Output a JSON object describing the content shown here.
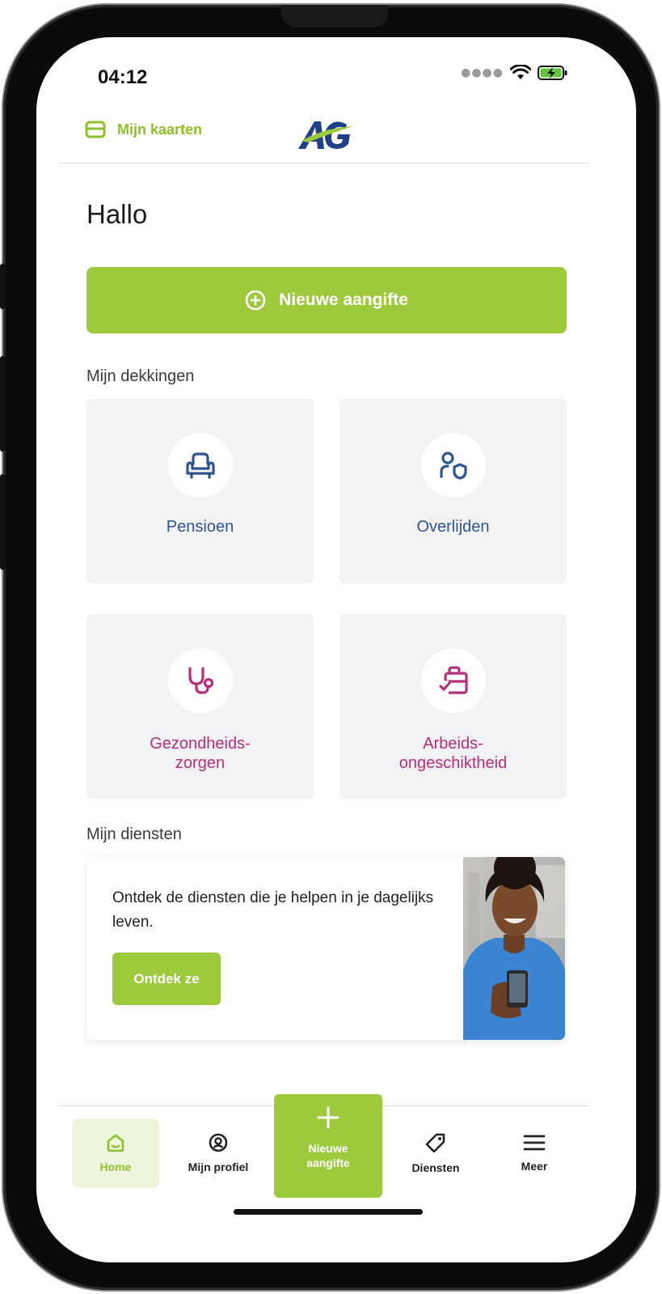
{
  "status_bar": {
    "time": "04:12"
  },
  "header": {
    "cards_label": "Mijn kaarten",
    "logo_text": "AG"
  },
  "greeting": "Hallo",
  "primary_action": {
    "label": "Nieuwe aangifte"
  },
  "coverages": {
    "title": "Mijn dekkingen",
    "items": [
      {
        "label": "Pensioen",
        "icon": "armchair-icon",
        "color": "#2f5593"
      },
      {
        "label": "Overlijden",
        "icon": "person-shield-icon",
        "color": "#2f5593"
      },
      {
        "label_line1": "Gezondheids-",
        "label_line2": "zorgen",
        "icon": "stethoscope-icon",
        "color": "#b72e7c"
      },
      {
        "label_line1": "Arbeids-",
        "label_line2": "ongeschiktheid",
        "icon": "briefcase-check-icon",
        "color": "#b72e7c"
      }
    ]
  },
  "services": {
    "title": "Mijn diensten",
    "text": "Ontdek de diensten die je helpen in je dagelijks leven.",
    "button_label": "Ontdek ze"
  },
  "tab_bar": {
    "items": [
      {
        "label": "Home",
        "icon": "home-icon",
        "active": true
      },
      {
        "label": "Mijn profiel",
        "icon": "profile-icon"
      },
      {
        "label_line1": "Nieuwe",
        "label_line2": "aangifte",
        "icon": "plus-icon"
      },
      {
        "label": "Diensten",
        "icon": "tag-icon"
      },
      {
        "label": "Meer",
        "icon": "menu-icon"
      }
    ]
  },
  "colors": {
    "brand_green": "#9dc93c",
    "brand_blue": "#2f5593",
    "brand_pink": "#b72e7c"
  }
}
